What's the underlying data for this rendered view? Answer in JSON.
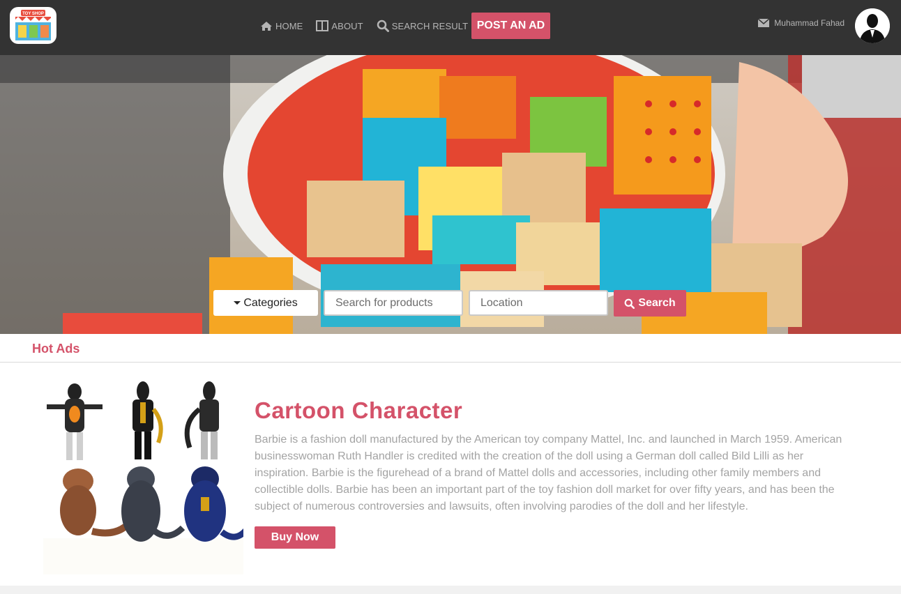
{
  "brand": {
    "logo_icon": "toy-shop-storefront-icon",
    "logo_text": "TOY SHOP"
  },
  "nav": {
    "items": [
      {
        "label": "HOME",
        "icon": "home-icon"
      },
      {
        "label": "ABOUT",
        "icon": "columns-icon"
      },
      {
        "label": "SEARCH RESULT",
        "icon": "search-icon"
      }
    ],
    "post_ad": "POST AN AD"
  },
  "user": {
    "name": "Muhammad Fahad",
    "mail_icon": "envelope-icon",
    "avatar_icon": "user-silhouette-icon"
  },
  "search": {
    "categories_label": "Categories",
    "product_placeholder": "Search for products",
    "location_placeholder": "Location",
    "button_label": "Search"
  },
  "hot_ads": {
    "title": "Hot Ads",
    "item": {
      "title": "Cartoon Character",
      "description": "Barbie is a fashion doll manufactured by the American toy company Mattel, Inc. and launched in March 1959. American businesswoman Ruth Handler is credited with the creation of the doll using a German doll called Bild Lilli as her inspiration. Barbie is the figurehead of a brand of Mattel dolls and accessories, including other family members and collectible dolls. Barbie has been an important part of the toy fashion doll market for over fifty years, and has been the subject of numerous controversies and lawsuits, often involving parodies of the doll and her lifestyle.",
      "buy_label": "Buy Now"
    }
  },
  "colors": {
    "accent": "#d45269",
    "navbar": "#333333",
    "nav_text": "#b5b5b5",
    "desc_text": "#a3a3a3"
  }
}
